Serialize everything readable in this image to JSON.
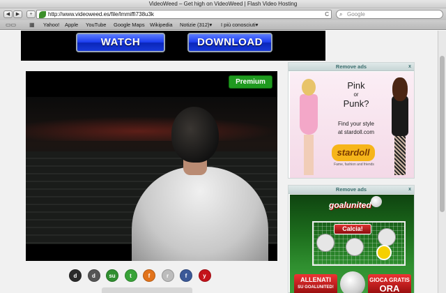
{
  "window": {
    "title": "VideoWeed – Get high on VideoWeed | Flash Video Hosting"
  },
  "toolbar": {
    "back": "◀",
    "forward": "▶",
    "add": "+",
    "url": "http://www.videoweed.es/file/lmmiffi738u3k",
    "reload": "C",
    "search_placeholder": "Google",
    "search_icon": "⌕"
  },
  "bookmarks": {
    "icons": [
      "book-icon",
      "grid-icon"
    ],
    "items": [
      "Yahoo!",
      "Apple",
      "YouTube",
      "Google Maps",
      "Wikipedia",
      "Notizie (312)▾",
      "I più conosciuti▾"
    ]
  },
  "banner": {
    "watch": "WATCH",
    "download": "DOWNLOAD"
  },
  "player": {
    "premium": "Premium"
  },
  "social": [
    {
      "icon": "delicious-icon",
      "glyph": "d",
      "color": "#2a2a2a"
    },
    {
      "icon": "digg-icon",
      "glyph": "d",
      "color": "#555555"
    },
    {
      "icon": "stumbleupon-icon",
      "glyph": "su",
      "color": "#2f8f2f"
    },
    {
      "icon": "technorati-icon",
      "glyph": "t",
      "color": "#38a338"
    },
    {
      "icon": "mixx-icon",
      "glyph": "f",
      "color": "#e2731b"
    },
    {
      "icon": "reddit-icon",
      "glyph": "r",
      "color": "#bcbcbc"
    },
    {
      "icon": "facebook-icon",
      "glyph": "f",
      "color": "#3b5998"
    },
    {
      "icon": "yahoo-buzz-icon",
      "glyph": "y",
      "color": "#c4121a"
    }
  ],
  "ads": {
    "remove_label": "Remove ads",
    "close": "x",
    "stardoll": {
      "pink": "Pink",
      "or": "or",
      "punk": "Punk?",
      "find_line1": "Find your style",
      "find_line2": "at stardoll.com",
      "logo": "stardoll",
      "tagline": "Fame, fashion and friends"
    },
    "goalunited": {
      "logo": "goalunited",
      "calcia": "Calcia!",
      "left_line1": "ALLENATI",
      "left_line2": "SU GOALUNITED!",
      "right_line1": "GIOCA GRATIS",
      "right_line2": "ORA"
    }
  }
}
